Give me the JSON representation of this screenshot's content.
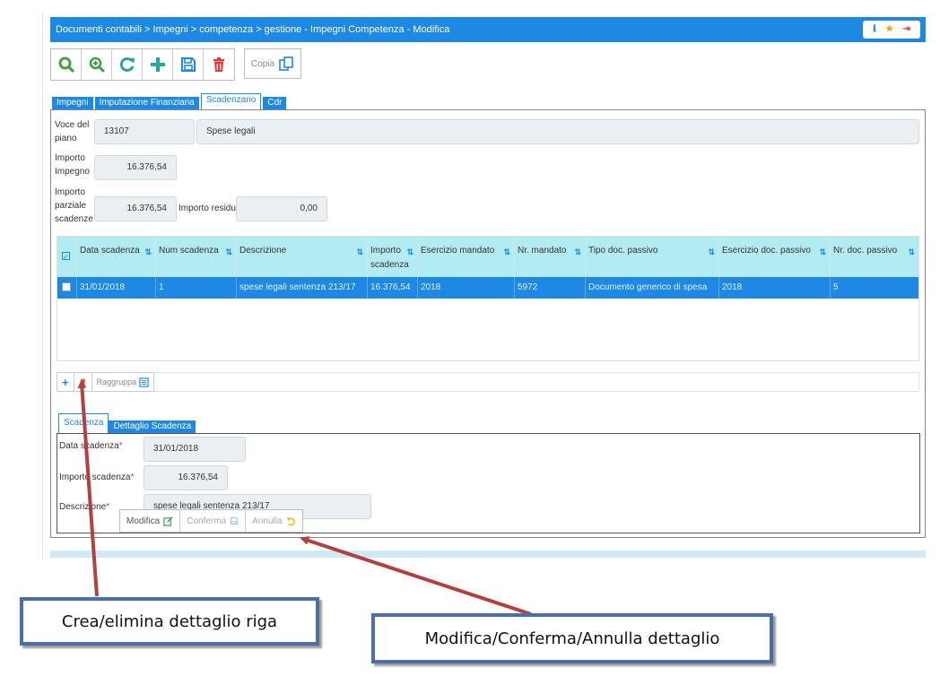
{
  "breadcrumb": "Documenti contabili > Impegni > competenza > gestione - Impegni Competenza - Modifica",
  "header_icons": {
    "info": "info-icon",
    "favorite": "star-icon",
    "exit": "logout-icon"
  },
  "toolbar": {
    "buttons": [
      "search-icon",
      "zoom-in-icon",
      "refresh-icon",
      "add-icon",
      "save-icon",
      "delete-icon"
    ],
    "copy_label": "Copia"
  },
  "tabs": [
    "Impegni",
    "Imputazione Finanziaria",
    "Scadenzario",
    "Cdr"
  ],
  "active_tab": "Scadenzario",
  "form": {
    "voce_label": "Voce del piano",
    "voce_code": "13107",
    "voce_desc": "Spese legali",
    "importo_impegno_label": "Importo Impegno",
    "importo_impegno": "16.376,54",
    "importo_parziale_label": "Importo parziale scadenze",
    "importo_parziale": "16.376,54",
    "importo_residuo_label": "Importo residuo",
    "importo_residuo": "0,00"
  },
  "grid": {
    "columns": [
      "Data scadenza",
      "Num scadenza",
      "Descrizione",
      "Importo scadenza",
      "Esercizio mandato",
      "Nr. mandato",
      "Tipo doc. passivo",
      "Esercizio doc. passivo",
      "Nr. doc. passivo"
    ],
    "rows": [
      [
        "31/01/2018",
        "1",
        "spese legali sentenza 213/17",
        "16.376,54",
        "2018",
        "5972",
        "Documento generico di spesa",
        "2018",
        "5"
      ]
    ],
    "raggruppa_label": "Raggruppa"
  },
  "subtabs": [
    "Scadenza",
    "Dettaglio Scadenza"
  ],
  "detail": {
    "data_label": "Data scadenza",
    "data_value": "31/01/2018",
    "importo_label": "Importo scadenza",
    "importo_value": "16.376,54",
    "descr_label": "Descrizione",
    "descr_value": "spese legali sentenza 213/17",
    "required_mark": "*",
    "modifica_label": "Modifica",
    "conferma_label": "Conferma",
    "annulla_label": "Annulla"
  },
  "callouts": {
    "left": "Crea/elimina dettaglio riga",
    "right": "Modifica/Conferma/Annulla dettaglio"
  },
  "colors": {
    "primary": "#1e88e5",
    "header_row": "#b2ebf2",
    "danger": "#e53935",
    "green": "#43a047",
    "teal": "#26a69a"
  }
}
